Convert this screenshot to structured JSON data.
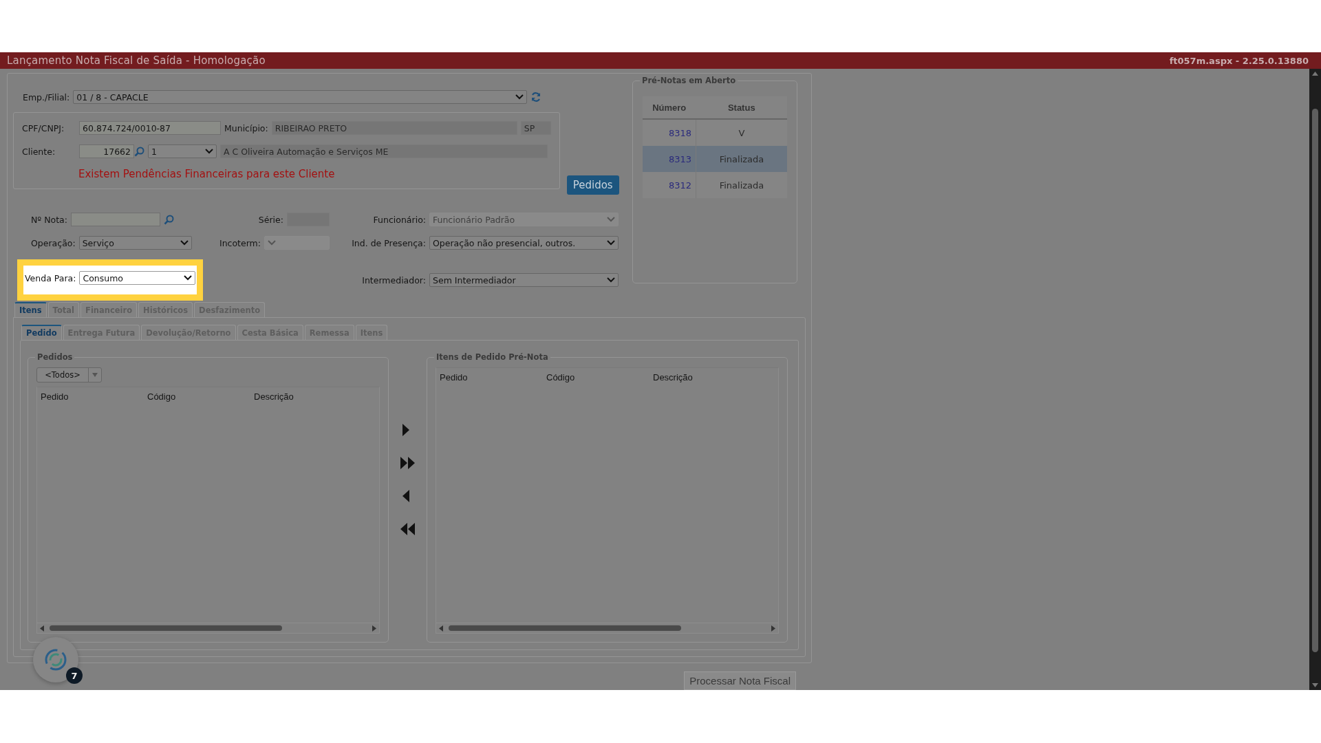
{
  "header": {
    "title": "Lançamento Nota Fiscal de Saída  - Homologação",
    "version": "ft057m.aspx - 2.25.0.13880"
  },
  "company": {
    "label": "Emp./Filial:",
    "value": "01 / 8 - CAPACLE"
  },
  "client": {
    "cpf_label": "CPF/CNPJ:",
    "cpf": "60.874.724/0010-87",
    "city_label": "Município:",
    "city": "RIBEIRAO PRETO",
    "state": "SP",
    "client_label": "Cliente:",
    "client_code": "17662",
    "client_seq": "1",
    "client_name": "A C Oliveira Automação e Serviços ME",
    "warning": "Existem Pendências Financeiras para este Cliente"
  },
  "orders_button": "Pedidos",
  "pre_notes": {
    "title": "Pré-Notas em Aberto",
    "columns": [
      "Número",
      "Status"
    ],
    "rows": [
      {
        "number": "8318",
        "status": "V",
        "selected": false
      },
      {
        "number": "8313",
        "status": "Finalizada",
        "selected": true
      },
      {
        "number": "8312",
        "status": "Finalizada",
        "selected": false
      }
    ]
  },
  "form": {
    "note_label": "Nº Nota:",
    "series_label": "Série:",
    "employee": {
      "label": "Funcionário:",
      "value": "Funcionário Padrão",
      "disabled": true
    },
    "operation": {
      "label": "Operação:",
      "value": "Serviço",
      "disabled": false
    },
    "incoterm": {
      "label": "Incoterm:",
      "disabled": true
    },
    "presence": {
      "label": "Ind. de Presença:",
      "value": "Operação não presencial, outros.",
      "disabled": false
    },
    "sale_for": {
      "label": "Venda Para:",
      "value": "Consumo",
      "highlighted": true
    },
    "intermediary": {
      "label": "Intermediador:",
      "value": "Sem Intermediador",
      "disabled": false
    }
  },
  "tabs": [
    {
      "label": "Itens",
      "selected": true
    },
    {
      "label": "Total",
      "selected": false
    },
    {
      "label": "Financeiro",
      "selected": false
    },
    {
      "label": "Históricos",
      "selected": false
    },
    {
      "label": "Desfazimento",
      "selected": false
    }
  ],
  "subtabs": [
    {
      "label": "Pedido",
      "selected": true
    },
    {
      "label": "Entrega Futura",
      "selected": false
    },
    {
      "label": "Devolução/Retorno",
      "selected": false
    },
    {
      "label": "Cesta Básica",
      "selected": false
    },
    {
      "label": "Remessa",
      "selected": false
    },
    {
      "label": "Itens",
      "selected": false
    }
  ],
  "orders": {
    "title": "Pedidos",
    "filter": "<Todos>",
    "columns": [
      "Pedido",
      "Código",
      "Descrição"
    ]
  },
  "items": {
    "title": "Itens de Pedido Pré-Nota",
    "columns": [
      "Pedido",
      "Código",
      "Descrição"
    ]
  },
  "chat": {
    "badge": "7"
  },
  "process_button": {
    "label": "Processar Nota Fiscal",
    "disabled": true
  }
}
